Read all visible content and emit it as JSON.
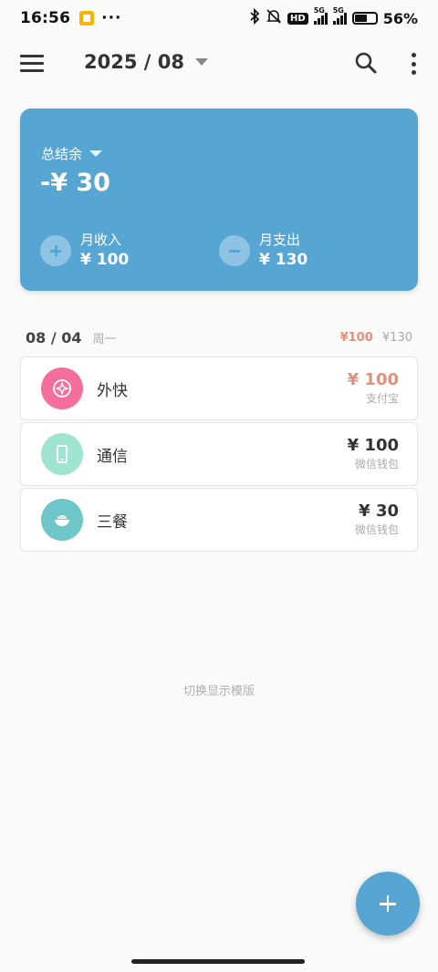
{
  "status_bar": {
    "time": "16:56",
    "dots": "···",
    "hd": "HD",
    "net1": "5G",
    "net2": "5G",
    "battery_pct": "56%",
    "battery_level": 0.56
  },
  "header": {
    "month": "2025 / 08"
  },
  "summary": {
    "label": "总结余",
    "balance": "-¥ 30",
    "income_label": "月收入",
    "income_value": "¥ 100",
    "expense_label": "月支出",
    "expense_value": "¥ 130",
    "card_color": "#57a5d2"
  },
  "day": {
    "date": "08 / 04",
    "weekday": "周一",
    "income_total": "¥100",
    "expense_total": "¥130"
  },
  "transactions": [
    {
      "name": "外快",
      "amount": "¥ 100",
      "account": "支付宝",
      "icon": "compass-icon",
      "icon_color": "#f46d9c",
      "amount_color": "#e0907c"
    },
    {
      "name": "通信",
      "amount": "¥ 100",
      "account": "微信钱包",
      "icon": "phone-icon",
      "icon_color": "#9fe4d2",
      "amount_color": "#333333"
    },
    {
      "name": "三餐",
      "amount": "¥ 30",
      "account": "微信钱包",
      "icon": "rice-bowl-icon",
      "icon_color": "#6fc6c8",
      "amount_color": "#333333"
    }
  ],
  "footer": {
    "switch_template": "切换显示模版"
  }
}
